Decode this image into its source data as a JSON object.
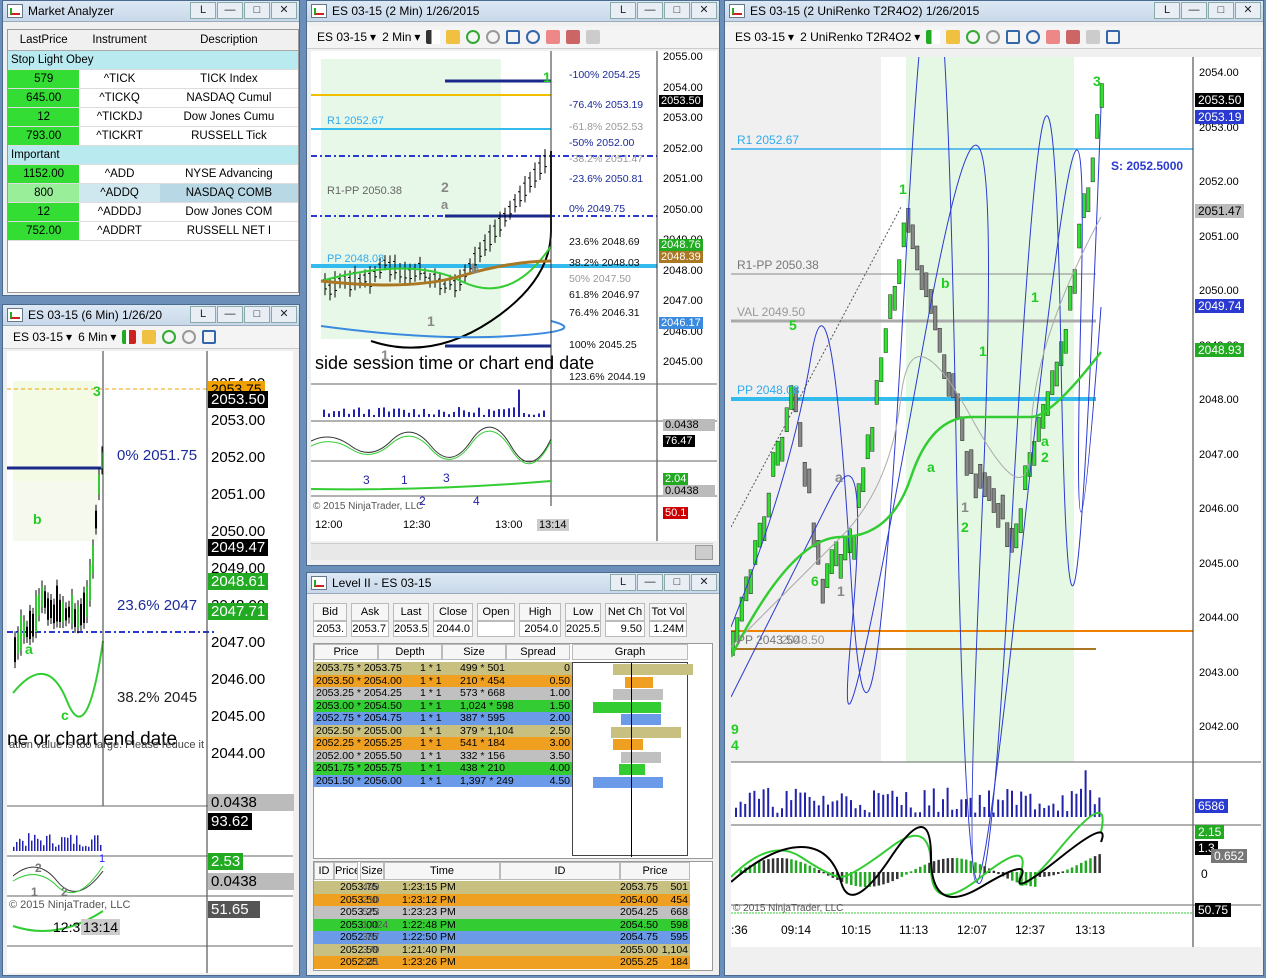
{
  "market_analyzer": {
    "title": "Market Analyzer",
    "columns": [
      "LastPrice",
      "Instrument",
      "Description"
    ],
    "groups": [
      {
        "name": "Stop Light Obey",
        "rows": [
          {
            "last": "579",
            "instrument": "^TICK",
            "description": "TICK Index"
          },
          {
            "last": "645.00",
            "instrument": "^TICKQ",
            "description": "NASDAQ Cumul"
          },
          {
            "last": "12",
            "instrument": "^TICKDJ",
            "description": "Dow Jones Cumu"
          },
          {
            "last": "793.00",
            "instrument": "^TICKRT",
            "description": "RUSSELL Tick"
          }
        ]
      },
      {
        "name": "Important",
        "rows": [
          {
            "last": "1152.00",
            "instrument": "^ADD",
            "description": "NYSE Advancing"
          },
          {
            "last": "800",
            "instrument": "^ADDQ",
            "description": "NASDAQ COMB"
          },
          {
            "last": "12",
            "instrument": "^ADDDJ",
            "description": "Dow Jones COM"
          },
          {
            "last": "752.00",
            "instrument": "^ADDRT",
            "description": "RUSSELL NET I"
          }
        ]
      }
    ]
  },
  "chart6": {
    "title": "ES 03-15 (6 Min)  1/26/20",
    "instrument": "ES 03-15",
    "interval": "6 Min",
    "prices": [
      "2054.00",
      "2053.00",
      "2052.00",
      "2051.00",
      "2050.00",
      "2049.00",
      "2048.00",
      "2047.00",
      "2046.00",
      "2045.00",
      "2044.00"
    ],
    "tags": [
      "2053.75",
      "2053.50",
      "2049.47",
      "2048.61",
      "2047.71"
    ],
    "fib": [
      "0%  2051.75",
      "23.6%  2047",
      "38.2%  2045"
    ],
    "notice": "ne or chart end date",
    "notice2": "ation value is too large. Please reduce it",
    "ind_tags": [
      "0.0438",
      "93.62",
      "2.53",
      "0.0438",
      "51.65"
    ],
    "copyright": "© 2015 NinjaTrader, LLC",
    "times": [
      "12:3",
      "13:14"
    ],
    "labels": [
      "3",
      "b",
      "a",
      "c",
      "2",
      "1",
      "2",
      "1"
    ]
  },
  "chart2": {
    "title": "ES 03-15 (2 Min)  1/26/2015",
    "instrument": "ES 03-15",
    "interval": "2 Min",
    "prices": [
      "2055.00",
      "2054.00",
      "2053.00",
      "2052.00",
      "2051.00",
      "2050.00",
      "2049.00",
      "2048.00",
      "2047.00",
      "2046.00",
      "2045.00"
    ],
    "tags": [
      "2053.50",
      "2048.76",
      "2048.39",
      "2046.17"
    ],
    "fib": [
      "-100%  2054.25",
      "-76.4%  2053.19",
      "-61.8%  2052.53",
      "-50%  2052.00",
      "-38.2%  2051.47",
      "-23.6%  2050.81",
      "0%  2049.75",
      "23.6%  2048.69",
      "38.2%  2048.03",
      "50%  2047.50",
      "61.8%  2046.97",
      "76.4%  2046.31",
      "100%  2045.25",
      "123.6%  2044.19"
    ],
    "pivots": [
      "R1 2052.67",
      "R1-PP 2050.38",
      "PP 2048.08"
    ],
    "notice": "side session time or chart end date",
    "ind_tags": [
      "0.0438",
      "76.47",
      "2.04",
      "0.0438",
      "50.1"
    ],
    "times": [
      "12:00",
      "12:30",
      "13:00",
      "13:14"
    ],
    "copyright": "© 2015 NinjaTrader, LLC",
    "labels": [
      "1",
      "2",
      "a",
      "b",
      "1",
      "1",
      "3",
      "1",
      "3",
      "2",
      "4"
    ]
  },
  "level2": {
    "title": "Level II - ES 03-15",
    "summary_headers": [
      "Bid",
      "Ask",
      "Last",
      "Close",
      "Open",
      "High",
      "Low",
      "Net Ch",
      "Tot Vol"
    ],
    "summary_values": [
      "2053.",
      "2053.7",
      "2053.5",
      "2044.0",
      "",
      "2054.0",
      "2025.5",
      "9.50",
      "1.24M"
    ],
    "book_headers": [
      "Price",
      "Depth",
      "Size",
      "Spread",
      "Graph"
    ],
    "book": [
      {
        "price": "2053.75 * 2053.75",
        "depth": "1 * 1",
        "size": "499 * 501",
        "spread": "0"
      },
      {
        "price": "2053.50 * 2054.00",
        "depth": "1 * 1",
        "size": "210 * 454",
        "spread": "0.50"
      },
      {
        "price": "2053.25 * 2054.25",
        "depth": "1 * 1",
        "size": "573 * 668",
        "spread": "1.00"
      },
      {
        "price": "2053.00 * 2054.50",
        "depth": "1 * 1",
        "size": "1,024 * 598",
        "spread": "1.50"
      },
      {
        "price": "2052.75 * 2054.75",
        "depth": "1 * 1",
        "size": "387 * 595",
        "spread": "2.00"
      },
      {
        "price": "2052.50 * 2055.00",
        "depth": "1 * 1",
        "size": "379 * 1,104",
        "spread": "2.50"
      },
      {
        "price": "2052.25 * 2055.25",
        "depth": "1 * 1",
        "size": "541 * 184",
        "spread": "3.00"
      },
      {
        "price": "2052.00 * 2055.50",
        "depth": "1 * 1",
        "size": "332 * 156",
        "spread": "3.50"
      },
      {
        "price": "2051.75 * 2055.75",
        "depth": "1 * 1",
        "size": "438 * 210",
        "spread": "4.00"
      },
      {
        "price": "2051.50 * 2056.00",
        "depth": "1 * 1",
        "size": "1,397 * 249",
        "spread": "4.50"
      }
    ],
    "ts_headers": [
      "ID",
      "Price",
      "Size",
      "Time",
      "ID",
      "Price"
    ],
    "ts_rows": [
      {
        "a": "2053.75",
        "b": "499",
        "time": "1:23:15 PM",
        "price": "2053.75",
        "size": "501"
      },
      {
        "a": "2053.50",
        "b": "210",
        "time": "1:23:12 PM",
        "price": "2054.00",
        "size": "454"
      },
      {
        "a": "2053.25",
        "b": "573",
        "time": "1:23:23 PM",
        "price": "2054.25",
        "size": "668"
      },
      {
        "a": "2053.00",
        "b": "1,024",
        "time": "1:22:48 PM",
        "price": "2054.50",
        "size": "598"
      },
      {
        "a": "2052.75",
        "b": "387",
        "time": "1:22:50 PM",
        "price": "2054.75",
        "size": "595"
      },
      {
        "a": "2052.50",
        "b": "379",
        "time": "1:21:40 PM",
        "price": "2055.00",
        "size": "1,104"
      },
      {
        "a": "2052.25",
        "b": "541",
        "time": "1:23:26 PM",
        "price": "2055.25",
        "size": "184"
      }
    ]
  },
  "renko": {
    "title": "ES 03-15 (2 UniRenko T2R4O2)  1/26/2015",
    "instrument": "ES 03-15",
    "interval": "2 UniRenko T2R4O2",
    "prices": [
      "2054.00",
      "2053.00",
      "2052.00",
      "2051.00",
      "2050.00",
      "2049.00",
      "2048.00",
      "2047.00",
      "2046.00",
      "2045.00",
      "2044.00",
      "2043.00",
      "2042.00"
    ],
    "tags": [
      "2053.50",
      "2053.19",
      "2051.47",
      "2049.74",
      "2048.93"
    ],
    "lines": [
      "R1 2052.67",
      "R1-PP 2050.38",
      "VAL 2049.50",
      "PP 2048.08",
      "PP 2043.50",
      "2048.50"
    ],
    "stop": "S: 2052.5000",
    "ind_tags": [
      "6586",
      "2.15",
      "1.3",
      "0.652",
      "50.75"
    ],
    "times": [
      ":36",
      "09:14",
      "10:15",
      "11:13",
      "12:07",
      "12:37",
      "13:13"
    ],
    "ind_zero": "0",
    "copyright": "© 2015 NinjaTrader, LLC",
    "labels": [
      "3",
      "1",
      "b",
      "5",
      "1",
      "1",
      "a",
      "a",
      "2",
      "a",
      "6",
      "1",
      "1",
      "2",
      "9",
      "4"
    ]
  },
  "colors": {
    "up": "#33dd33",
    "down": "#888888",
    "pivot": "#33bbee",
    "fib_blue": "#1a2a8a"
  }
}
